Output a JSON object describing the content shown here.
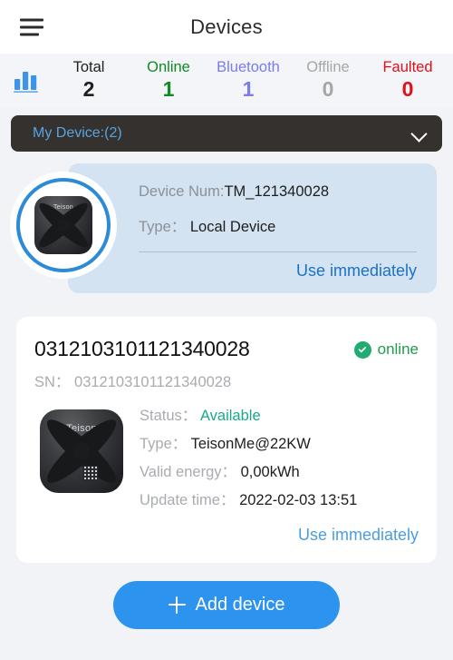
{
  "header": {
    "title": "Devices",
    "menu_icon": "hamburger-icon"
  },
  "stats": {
    "icon": "bar-chart-icon",
    "items": [
      {
        "label": "Total",
        "value": "2",
        "color": "#1e1e1e"
      },
      {
        "label": "Online",
        "value": "1",
        "color": "#0f8b23"
      },
      {
        "label": "Bluetooth",
        "value": "1",
        "color": "#7b7bef"
      },
      {
        "label": "Offline",
        "value": "0",
        "color": "#a6a6a6"
      },
      {
        "label": "Faulted",
        "value": "0",
        "color": "#e10f18"
      }
    ]
  },
  "group_selector": {
    "label": "My Device:(2)",
    "chevron_icon": "chevron-down-icon",
    "background": "#35312f",
    "text_color": "#5aa3e0"
  },
  "local_device": {
    "avatar_icon": "ev-charger-device-image",
    "device_num_key": "Device Num:",
    "device_num_value": "TM_121340028",
    "type_key": "Type：",
    "type_value": "Local Device",
    "action_label": "Use immediately",
    "card_background": "#d3e3f2",
    "ring_color": "#2d8ad6",
    "link_color": "#1b72c4"
  },
  "online_device": {
    "device_id": "0312103101121340028",
    "sn_key": "SN：",
    "sn_value": "0312103101121340028",
    "status_badge": {
      "icon": "check-circle-icon",
      "text": "online",
      "color": "#1f9d4c"
    },
    "thumb_icon": "ev-charger-device-image",
    "rows": [
      {
        "key": "Status：",
        "value": "Available",
        "value_color": "#1aa98a"
      },
      {
        "key": "Type：",
        "value": "TeisonMe@22KW",
        "value_color": "#1d1d1d"
      },
      {
        "key": "Valid energy：",
        "value": "0,00kWh",
        "value_color": "#1d1d1d"
      },
      {
        "key": "Update time：",
        "value": "2022-02-03 13:51",
        "value_color": "#1d1d1d"
      }
    ],
    "action_label": "Use immediately",
    "link_color": "#4a9ede"
  },
  "add_button": {
    "label": "Add device",
    "icon": "plus-icon",
    "background": "#2c93ef",
    "text_color": "#ffffff"
  },
  "brand": {
    "device_wordmark": "Teison"
  },
  "page_background": "#f2f3f7"
}
